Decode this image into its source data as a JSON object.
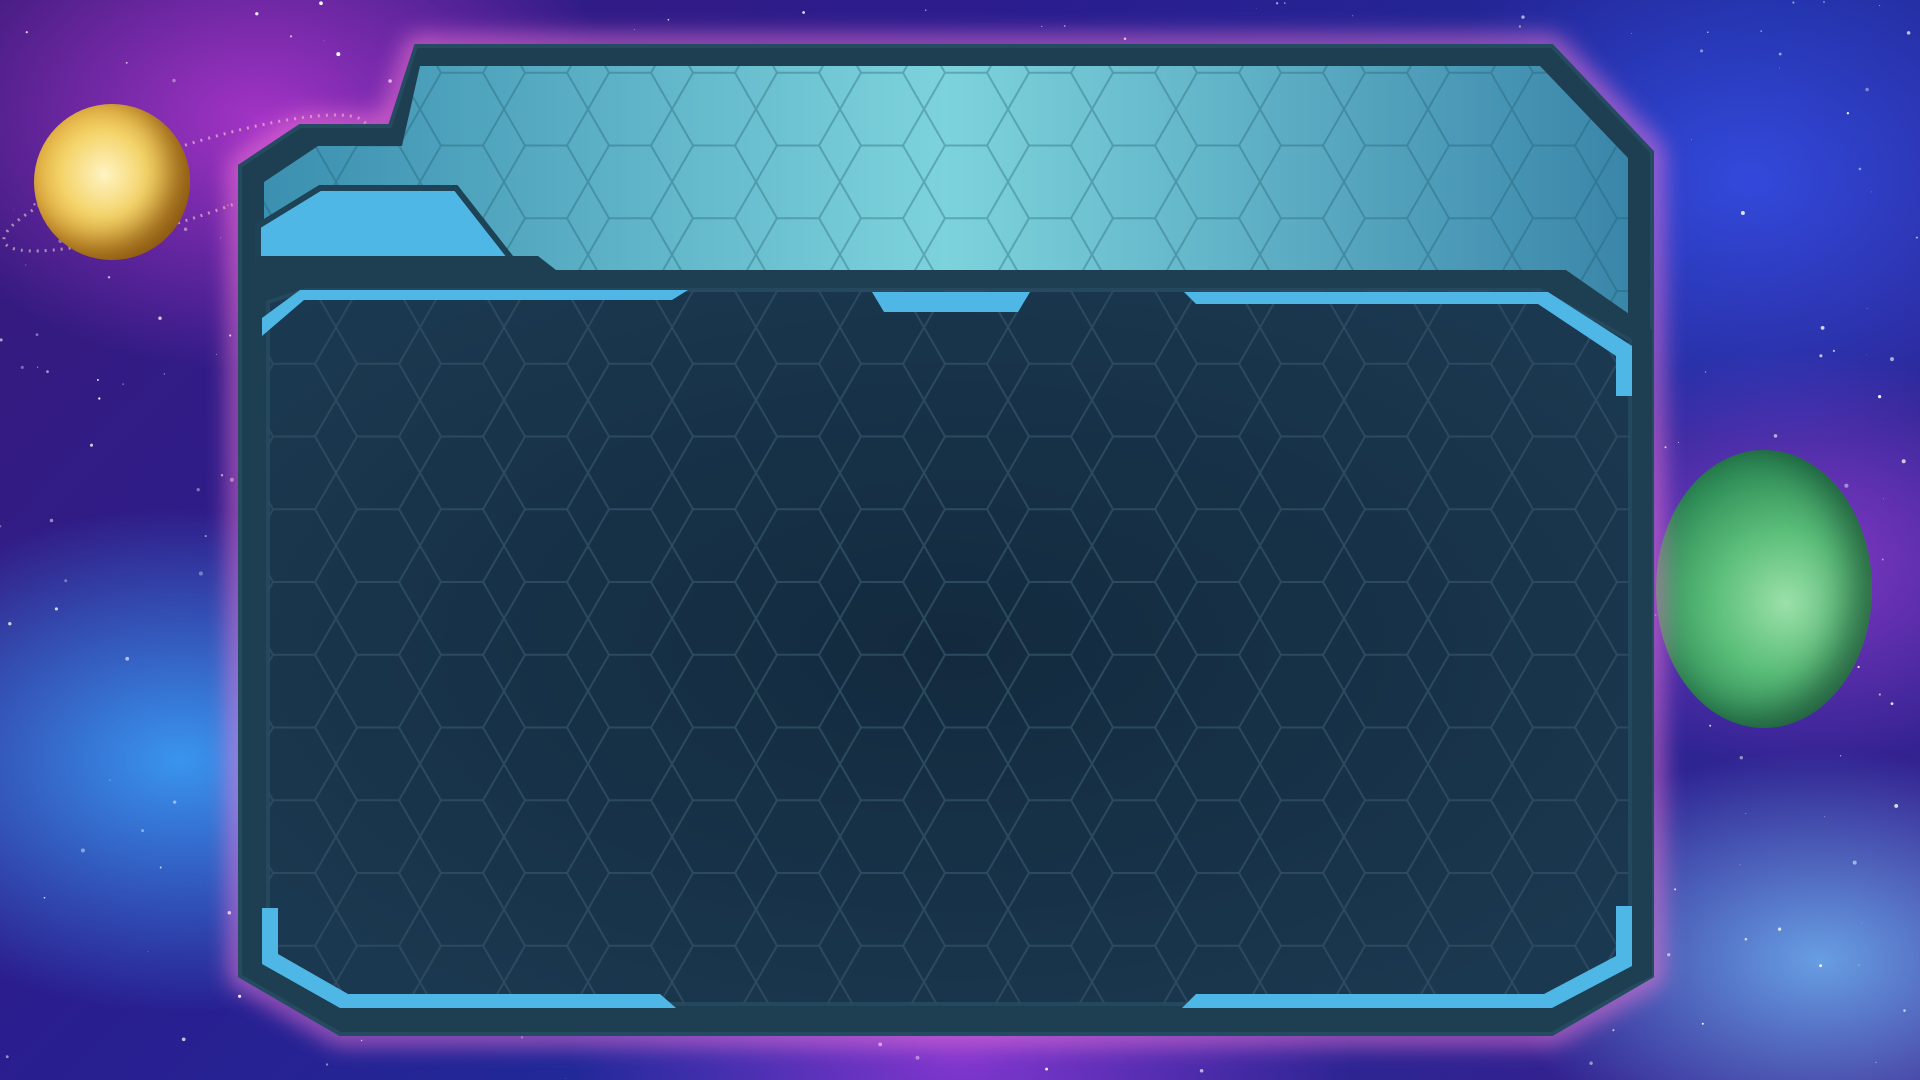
{
  "scene": {
    "type": "stream-overlay-frame",
    "theme": "space",
    "panel_content": ""
  },
  "colors": {
    "frame_outer": "#1e3f52",
    "frame_glow": "#ff7ad9",
    "tab_fill": "#5fc2d6",
    "accent": "#4fb7e6",
    "screen_fill": "#13273a",
    "hex_line": "#2b4a5f"
  },
  "icons": {
    "left_planet": "yellow-ringed-planet",
    "right_planet": "green-planet"
  }
}
